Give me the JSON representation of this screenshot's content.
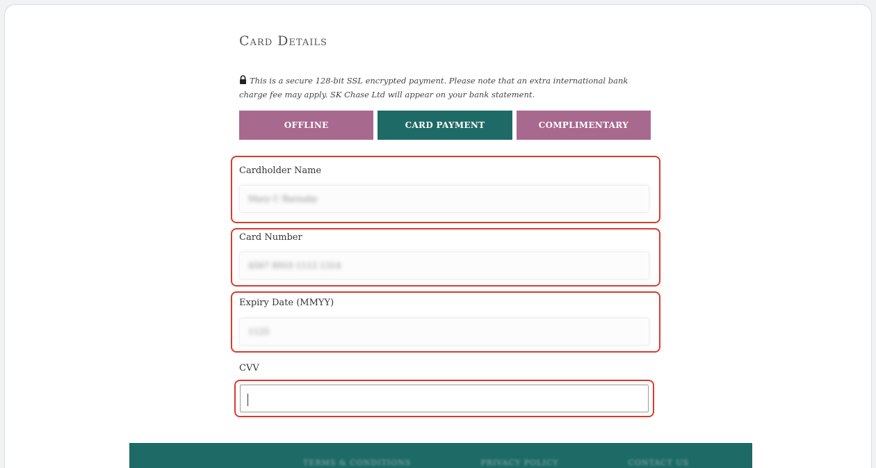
{
  "page": {
    "heading": "Card Details",
    "notice": "This is a secure 128-bit SSL encrypted payment. Please note that an extra international bank charge fee may apply. SK Chase Ltd will appear on your bank statement."
  },
  "tabs": [
    {
      "label": "OFFLINE",
      "active": false
    },
    {
      "label": "CARD PAYMENT",
      "active": true
    },
    {
      "label": "COMPLIMENTARY",
      "active": false
    }
  ],
  "form": {
    "cardholder_name": {
      "label": "Cardholder Name",
      "value": "Mary C Barnaby"
    },
    "card_number": {
      "label": "Card Number",
      "value": "4567 8910 1112 1314"
    },
    "expiry_date": {
      "label": "Expiry Date (MMYY)",
      "value": "1125"
    },
    "cvv": {
      "label": "CVV",
      "value": ""
    }
  },
  "footer": {
    "links": [
      "TERMS & CONDITIONS",
      "PRIVACY POLICY",
      "CONTACT US"
    ]
  },
  "colors": {
    "tab_inactive": "#a8698f",
    "tab_active": "#1e6a66",
    "highlight": "#d93a2b",
    "footer_bg": "#1e6a66"
  }
}
